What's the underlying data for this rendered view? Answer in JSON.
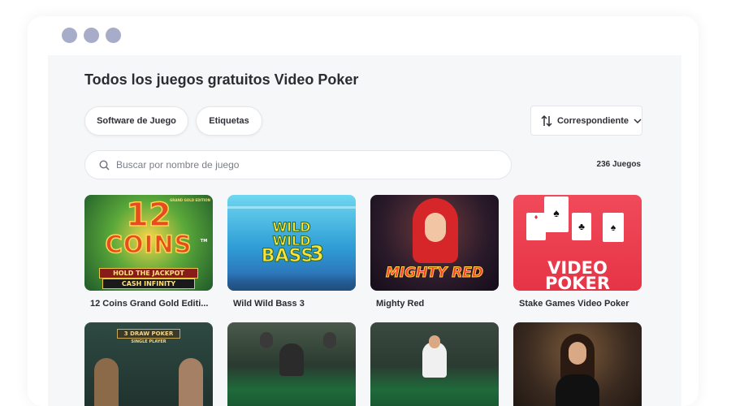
{
  "page": {
    "title": "Todos los juegos gratuitos Video Poker"
  },
  "filters": {
    "software_label": "Software de Juego",
    "tags_label": "Etiquetas",
    "sort_label": "Correspondiente"
  },
  "search": {
    "placeholder": "Buscar por nombre de juego",
    "value": ""
  },
  "results": {
    "count_label": "236 Juegos"
  },
  "games": [
    {
      "title": "12 Coins Grand Gold Editi...",
      "art": {
        "main": "12",
        "sub": "COINS",
        "tagline1": "HOLD THE JACKPOT",
        "tagline2": "CASH INFINITY",
        "badge": "GRAND GOLD EDITION",
        "tm": "TM"
      }
    },
    {
      "title": "Wild Wild Bass 3",
      "art": {
        "line1": "WILD",
        "line2": "WILD",
        "line3": "BASS",
        "num": "3"
      }
    },
    {
      "title": "Mighty Red",
      "art": {
        "logo": "MIGHTY RED"
      }
    },
    {
      "title": "Stake Games Video Poker",
      "art": {
        "line1": "VIDEO",
        "line2": "POKER"
      }
    },
    {
      "title": "",
      "art": {
        "banner": "3 DRAW POKER",
        "sub": "SINGLE PLAYER"
      }
    },
    {
      "title": "",
      "art": {}
    },
    {
      "title": "",
      "art": {}
    },
    {
      "title": "",
      "art": {}
    }
  ],
  "colors": {
    "accent_dot": "#a7adc8",
    "background": "#f6f7f8",
    "text": "#2c2d33"
  }
}
